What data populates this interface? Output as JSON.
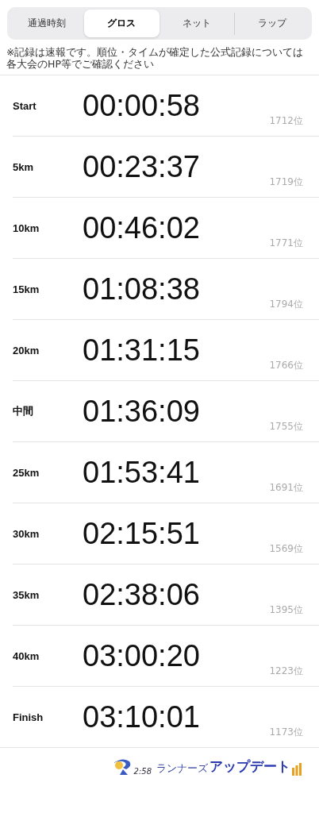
{
  "tabs": [
    {
      "label": "通過時刻",
      "selected": false
    },
    {
      "label": "グロス",
      "selected": true
    },
    {
      "label": "ネット",
      "selected": false
    },
    {
      "label": "ラップ",
      "selected": false
    }
  ],
  "note": "※記録は速報です。順位・タイムが確定した公式記録については各大会のHP等でご確認ください",
  "splits": [
    {
      "point": "Start",
      "time": "00:00:58",
      "rank": "1712位"
    },
    {
      "point": "5km",
      "time": "00:23:37",
      "rank": "1719位"
    },
    {
      "point": "10km",
      "time": "00:46:02",
      "rank": "1771位"
    },
    {
      "point": "15km",
      "time": "01:08:38",
      "rank": "1794位"
    },
    {
      "point": "20km",
      "time": "01:31:15",
      "rank": "1766位"
    },
    {
      "point": "中間",
      "time": "01:36:09",
      "rank": "1755位"
    },
    {
      "point": "25km",
      "time": "01:53:41",
      "rank": "1691位"
    },
    {
      "point": "30km",
      "time": "02:15:51",
      "rank": "1569位"
    },
    {
      "point": "35km",
      "time": "02:38:06",
      "rank": "1395位"
    },
    {
      "point": "40km",
      "time": "03:00:20",
      "rank": "1223位"
    },
    {
      "point": "Finish",
      "time": "03:10:01",
      "rank": "1173位"
    }
  ],
  "logo": {
    "time": "2:58",
    "brand": "ランナーズ",
    "title": "アップデート"
  }
}
